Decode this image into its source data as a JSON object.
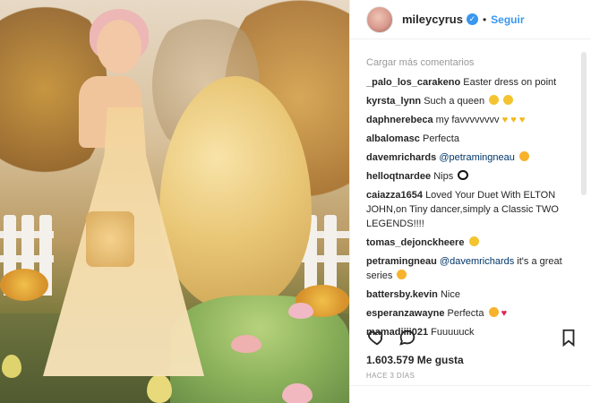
{
  "post": {
    "username": "mileycyrus",
    "follow_label": "Seguir",
    "separator": "•",
    "verified_icon": "check-badge-icon"
  },
  "comments": {
    "load_more": "Cargar más comentarios",
    "items": [
      {
        "user": "_palo_los_carakeno",
        "text": "Easter dress on point",
        "mention": "",
        "emojis": []
      },
      {
        "user": "kyrsta_lynn",
        "text": "Such a queen",
        "mention": "",
        "emojis": [
          "crying",
          "crying"
        ]
      },
      {
        "user": "daphnerebeca",
        "text": "my favvvvvvvv",
        "mention": "",
        "emojis": [
          "yellow-heart",
          "yellow-heart",
          "yellow-heart"
        ]
      },
      {
        "user": "albalomasc",
        "text": "Perfecta",
        "mention": "",
        "emojis": []
      },
      {
        "user": "davemrichards",
        "text": "",
        "mention": "@petramingneau",
        "emojis": [
          "heart-eyes"
        ]
      },
      {
        "user": "helloqtnardee",
        "text": "Nips",
        "mention": "",
        "emojis": [
          "eyes"
        ]
      },
      {
        "user": "caiazza1654",
        "text": "Loved Your Duet With ELTON JOHN,on Tiny dancer,simply a Classic TWO LEGENDS!!!!",
        "mention": "",
        "emojis": []
      },
      {
        "user": "tomas_dejonckheere",
        "text": "",
        "mention": "",
        "emojis": [
          "smile"
        ]
      },
      {
        "user": "petramingneau",
        "text": "it's a great series",
        "mention": "@davemrichards",
        "emojis": [
          "heart-eyes"
        ]
      },
      {
        "user": "battersby.kevin",
        "text": "Nice",
        "mention": "",
        "emojis": []
      },
      {
        "user": "esperanzawayne",
        "text": "Perfecta",
        "mention": "",
        "emojis": [
          "heart-eyes",
          "red-heart"
        ]
      },
      {
        "user": "mamadiiii021",
        "text": "Fuuuuuck",
        "mention": "",
        "emojis": []
      }
    ]
  },
  "actions": {
    "like_icon": "heart-outline-icon",
    "comment_icon": "comment-bubble-icon",
    "save_icon": "bookmark-icon"
  },
  "likes": "1.603.579 Me gusta",
  "time": "HACE 3 DÍAS",
  "colors": {
    "link": "#3897f0",
    "mention": "#003569"
  }
}
